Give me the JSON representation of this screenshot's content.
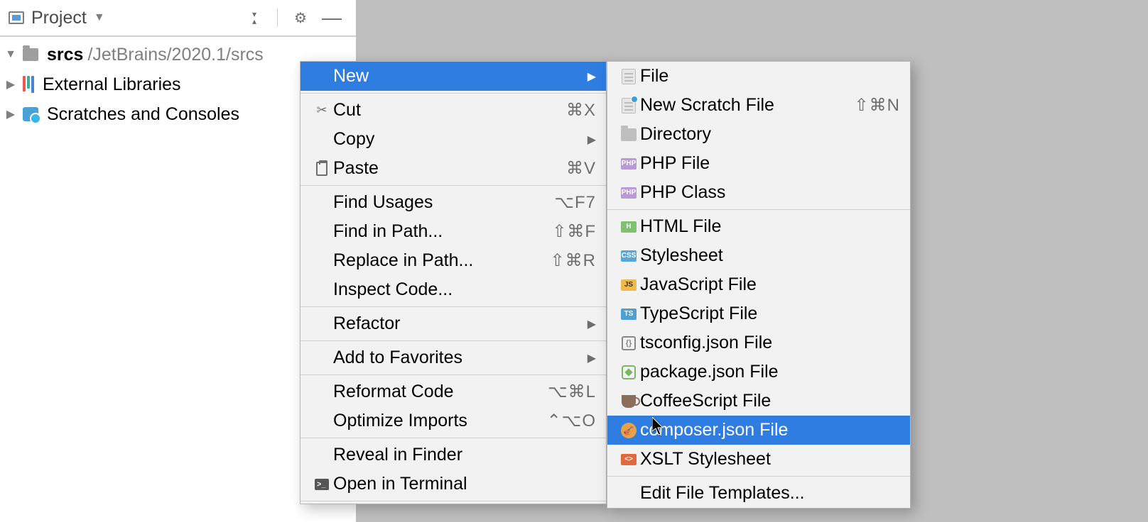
{
  "projectHeader": {
    "label": "Project"
  },
  "tree": {
    "root": {
      "name": "srcs",
      "path": "/JetBrains/2020.1/srcs"
    },
    "externalLibraries": "External Libraries",
    "scratches": "Scratches and Consoles"
  },
  "contextMenu": {
    "items": [
      {
        "label": "New",
        "hasSubmenu": true,
        "selected": true
      },
      {
        "sep": true
      },
      {
        "icon": "scissors",
        "label": "Cut",
        "shortcut": "⌘X"
      },
      {
        "label": "Copy",
        "hasSubmenu": true
      },
      {
        "icon": "clipboard",
        "label": "Paste",
        "shortcut": "⌘V"
      },
      {
        "sep": true
      },
      {
        "label": "Find Usages",
        "shortcut": "⌥F7"
      },
      {
        "label": "Find in Path...",
        "shortcut": "⇧⌘F"
      },
      {
        "label": "Replace in Path...",
        "shortcut": "⇧⌘R"
      },
      {
        "label": "Inspect Code..."
      },
      {
        "sep": true
      },
      {
        "label": "Refactor",
        "hasSubmenu": true
      },
      {
        "sep": true
      },
      {
        "label": "Add to Favorites",
        "hasSubmenu": true
      },
      {
        "sep": true
      },
      {
        "label": "Reformat Code",
        "shortcut": "⌥⌘L"
      },
      {
        "label": "Optimize Imports",
        "shortcut": "⌃⌥O"
      },
      {
        "sep": true
      },
      {
        "label": "Reveal in Finder"
      },
      {
        "icon": "terminal",
        "label": "Open in Terminal"
      },
      {
        "sep": true
      }
    ]
  },
  "newSubmenu": {
    "items": [
      {
        "icon": "file-plain",
        "label": "File"
      },
      {
        "icon": "file-scratch",
        "label": "New Scratch File",
        "shortcut": "⇧⌘N"
      },
      {
        "icon": "directory",
        "label": "Directory"
      },
      {
        "icon": "php",
        "label": "PHP File"
      },
      {
        "icon": "php",
        "label": "PHP Class"
      },
      {
        "sep": true
      },
      {
        "icon": "html",
        "label": "HTML File"
      },
      {
        "icon": "css",
        "label": "Stylesheet"
      },
      {
        "icon": "js",
        "label": "JavaScript File"
      },
      {
        "icon": "ts",
        "label": "TypeScript File"
      },
      {
        "icon": "tsjson",
        "label": "tsconfig.json File"
      },
      {
        "icon": "node",
        "label": "package.json File"
      },
      {
        "icon": "coffee",
        "label": "CoffeeScript File"
      },
      {
        "icon": "composer",
        "label": "composer.json File",
        "selected": true
      },
      {
        "icon": "xslt",
        "label": "XSLT Stylesheet"
      },
      {
        "sep": true
      },
      {
        "label": "Edit File Templates..."
      }
    ]
  },
  "iconText": {
    "php": "PHP",
    "html": "H",
    "css": "CSS",
    "js": "JS",
    "ts": "TS",
    "xslt": "<>",
    "terminal": ">_"
  }
}
